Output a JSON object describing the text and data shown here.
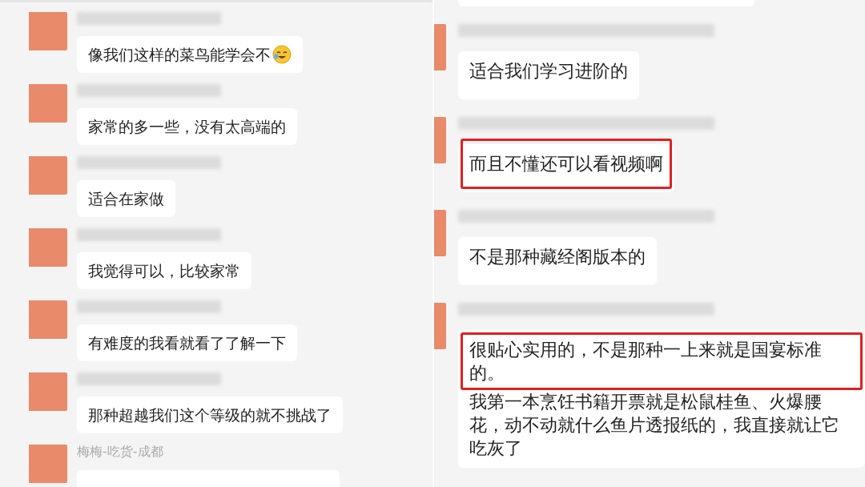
{
  "left_chat": {
    "messages": [
      {
        "kind": "text_emoji",
        "paragraphs": [
          {
            "text": "像我们这样的菜鸟能学会不",
            "highlighted": false
          }
        ]
      },
      {
        "kind": "text",
        "paragraphs": [
          {
            "text": "家常的多一些，没有太高端的",
            "highlighted": false
          }
        ]
      },
      {
        "kind": "text",
        "paragraphs": [
          {
            "text": "适合在家做",
            "highlighted": false
          }
        ]
      },
      {
        "kind": "text",
        "paragraphs": [
          {
            "text": "我觉得可以，比较家常",
            "highlighted": false
          }
        ]
      },
      {
        "kind": "text",
        "paragraphs": [
          {
            "text": "有难度的我看就看了了解一下",
            "highlighted": false
          }
        ]
      },
      {
        "kind": "text",
        "paragraphs": [
          {
            "text": "那种超越我们这个等级的就不挑战了",
            "highlighted": false
          }
        ]
      },
      {
        "kind": "text",
        "name": "梅梅-吃货-成都"
      }
    ]
  },
  "right_chat": {
    "messages": [
      {
        "kind": "text",
        "paragraphs": [
          {
            "text": "适合我们学习进阶的",
            "highlighted": false
          }
        ]
      },
      {
        "kind": "text",
        "paragraphs": [
          {
            "text": "而且不懂还可以看视频啊",
            "highlighted": true
          }
        ]
      },
      {
        "kind": "text",
        "paragraphs": [
          {
            "text": "不是那种藏经阁版本的",
            "highlighted": false
          }
        ]
      },
      {
        "kind": "text",
        "paragraphs": [
          {
            "text": "很贴心实用的，不是那种一上来就是国宴标准的。",
            "highlighted": true
          },
          {
            "text": "我第一本烹饪书籍开票就是松鼠桂鱼、火爆腰花，动不动就什么鱼片透报纸的，我直接就让它吃灰了",
            "highlighted": false
          }
        ]
      }
    ]
  }
}
